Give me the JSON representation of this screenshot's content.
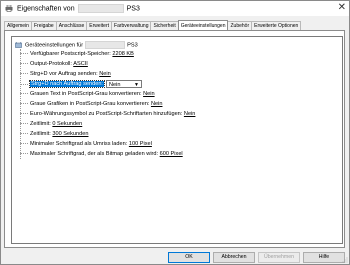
{
  "window": {
    "title_prefix": "Eigenschaften von",
    "title_suffix": "PS3",
    "close_label": "✕"
  },
  "tabs": [
    {
      "label": "Allgemein"
    },
    {
      "label": "Freigabe"
    },
    {
      "label": "Anschlüsse"
    },
    {
      "label": "Erweitert"
    },
    {
      "label": "Farbverwaltung"
    },
    {
      "label": "Sicherheit"
    },
    {
      "label": "Geräteeinstellungen",
      "active": true
    },
    {
      "label": "Zubehör"
    },
    {
      "label": "Erweiterte Optionen"
    }
  ],
  "tree": {
    "root_prefix": "Geräteeinstellungen für",
    "root_suffix": "PS3",
    "items": [
      {
        "label": "Verfügbarer Postscript-Speicher:",
        "value": "2208 KB"
      },
      {
        "label": "Output-Protokoll:",
        "value": "ASCII"
      },
      {
        "label": "Strg+D vor Auftrag senden:",
        "value": "Nein"
      },
      {
        "label": "Strg+D nach Auftrag senden:",
        "value": "Nein"
      },
      {
        "label": "Grauen Text in PostScript-Grau konvertieren:",
        "value": "Nein"
      },
      {
        "label": "Graue Grafiken in PostScript-Grau konvertieren:",
        "value": "Nein"
      },
      {
        "label": "Euro-Währungssymbol zu PostScript-Schriftarten hinzufügen:",
        "value": "Nein"
      },
      {
        "label": "Zeitlimit:",
        "value": "0 Sekunden"
      },
      {
        "label": "Zeitlimit:",
        "value": "300 Sekunden"
      },
      {
        "label": "Minimaler Schriftgrad als Umriss laden:",
        "value": "100 Pixel"
      },
      {
        "label": "Maximaler Schriftgrad, der als Bitmap geladen wird:",
        "value": "600 Pixel"
      }
    ]
  },
  "buttons": {
    "ok": "OK",
    "cancel": "Abbrechen",
    "apply": "Übernehmen",
    "help": "Hilfe"
  }
}
